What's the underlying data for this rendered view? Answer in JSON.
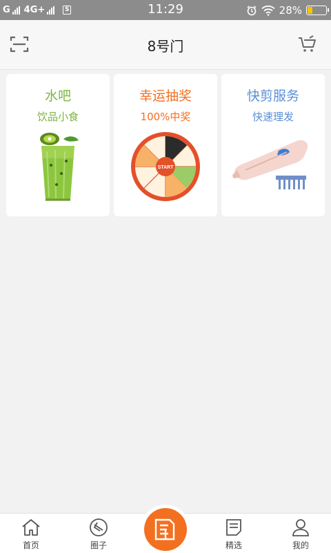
{
  "status_bar": {
    "carrier1": "G",
    "carrier2": "4G+",
    "sim_label": "S",
    "time": "11:29",
    "battery": "28%",
    "battery_level": 0.28
  },
  "header": {
    "title": "8号门",
    "scan_icon": "scan-icon",
    "cart_icon": "cart-icon"
  },
  "cards": [
    {
      "title": "水吧",
      "subtitle": "饮品小食",
      "title_color": "#7cb342",
      "sub_color": "#7cb342"
    },
    {
      "title": "幸运抽奖",
      "subtitle": "100%中奖",
      "title_color": "#f37021",
      "sub_color": "#f37021"
    },
    {
      "title": "快剪服务",
      "subtitle": "快速理发",
      "title_color": "#5a8fd6",
      "sub_color": "#5a8fd6"
    }
  ],
  "wheel": {
    "center_text": "START"
  },
  "tabbar": {
    "tabs": [
      {
        "label": "首页",
        "icon": "home-icon"
      },
      {
        "label": "圈子",
        "icon": "circle-icon"
      },
      {
        "label": "精选",
        "icon": "note-icon"
      },
      {
        "label": "我的",
        "icon": "user-icon"
      }
    ],
    "center_icon": "brand-logo-icon",
    "accent": "#f37021"
  }
}
